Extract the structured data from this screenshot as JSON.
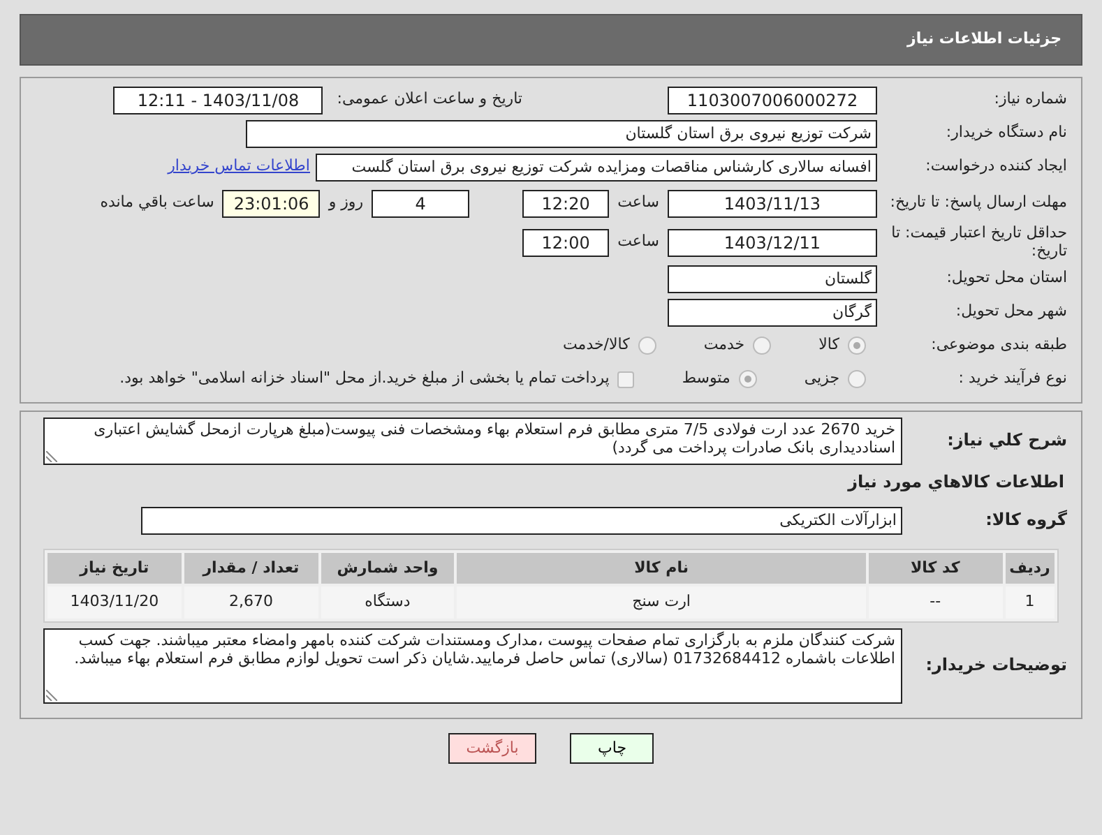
{
  "header": {
    "title": "جزئیات اطلاعات نیاز"
  },
  "need_number": {
    "label": "شماره نیاز:",
    "value": "1103007006000272"
  },
  "announce": {
    "label": "تاریخ و ساعت اعلان عمومی:",
    "value": "1403/11/08 - 12:11"
  },
  "buyer_org": {
    "label": "نام دستگاه خریدار:",
    "value": "شرکت توزیع نیروی برق استان گلستان"
  },
  "requester": {
    "label": "ایجاد کننده درخواست:",
    "value": "افسانه سالاری کارشناس مناقصات ومزایده شرکت توزیع نیروی برق استان گلست",
    "link": "اطلاعات تماس خریدار"
  },
  "reply_deadline": {
    "label": "مهلت ارسال پاسخ: تا تاریخ:",
    "date": "1403/11/13",
    "time_label": "ساعت",
    "time": "12:20",
    "days": "4",
    "days_label": "روز و",
    "remaining": "23:01:06",
    "remaining_label": "ساعت باقي مانده"
  },
  "price_validity": {
    "label": "حداقل تاریخ اعتبار قیمت: تا تاریخ:",
    "date": "1403/12/11",
    "time_label": "ساعت",
    "time": "12:00"
  },
  "province": {
    "label": "استان محل تحویل:",
    "value": "گلستان"
  },
  "city": {
    "label": "شهر محل تحویل:",
    "value": "گرگان"
  },
  "category": {
    "label": "طبقه بندی موضوعی:",
    "options": [
      {
        "label": "کالا",
        "selected": true
      },
      {
        "label": "خدمت",
        "selected": false
      },
      {
        "label": "کالا/خدمت",
        "selected": false
      }
    ]
  },
  "process": {
    "label": "نوع فرآیند خرید :",
    "options": [
      {
        "label": "جزیی",
        "selected": false
      },
      {
        "label": "متوسط",
        "selected": true
      }
    ],
    "treasury": {
      "label": "پرداخت تمام یا بخشی از مبلغ خرید.از محل \"اسناد خزانه اسلامی\" خواهد بود.",
      "checked": false
    }
  },
  "description": {
    "label": "شرح کلي نیاز:",
    "value": "خرید 2670 عدد ارت فولادی 7/5 متری مطابق فرم استعلام بهاء ومشخصات فنی پیوست(مبلغ هرپارت ازمحل گشایش اعتباری اسناددیداری بانک صادرات پرداخت می گردد)"
  },
  "goods_title": "اطلاعات کالاهاي مورد نیاز",
  "goods_group": {
    "label": "گروه کالا:",
    "value": "ابزارآلات الکتریکی"
  },
  "table": {
    "columns": [
      "ردیف",
      "کد کالا",
      "نام کالا",
      "واحد شمارش",
      "تعداد / مقدار",
      "تاریخ نیاز"
    ],
    "rows": [
      [
        "1",
        "--",
        "ارت سنج",
        "دستگاه",
        "2,670",
        "1403/11/20"
      ]
    ]
  },
  "buyer_notes": {
    "label": "توضیحات خریدار:",
    "value": "شرکت کنندگان ملزم به بارگزاری تمام صفحات پیوست ،مدارک ومستندات شرکت کننده بامهر وامضاء معتبر میباشند. جهت کسب اطلاعات باشماره 01732684412 (سالاری) تماس حاصل فرمایید.شایان ذکر است تحویل لوازم مطابق فرم استعلام بهاء میباشد."
  },
  "buttons": [
    {
      "label": "چاپ",
      "kind": "print"
    },
    {
      "label": "بازگشت",
      "kind": "back"
    }
  ]
}
